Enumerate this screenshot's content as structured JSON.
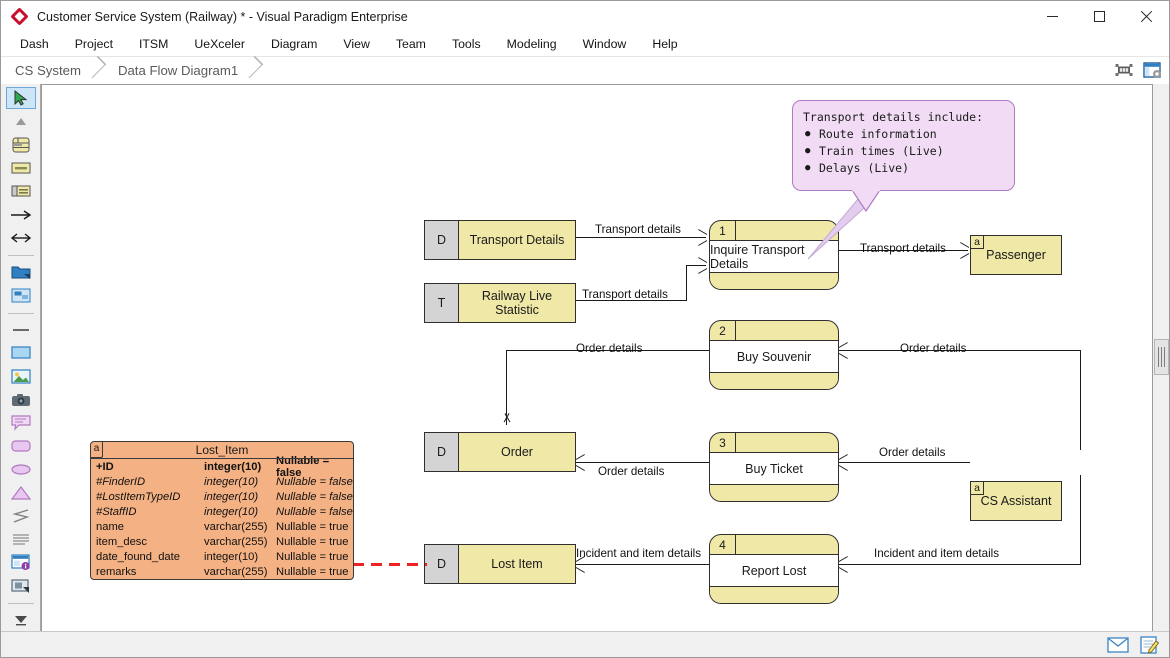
{
  "window": {
    "title": "Customer Service System (Railway) * - Visual Paradigm Enterprise",
    "logo_icon": "vp-diamond-logo-icon",
    "minimize_label": "—",
    "maximize_label": "□",
    "close_label": "✕"
  },
  "menubar": {
    "items": [
      {
        "label": "Dash"
      },
      {
        "label": "Project"
      },
      {
        "label": "ITSM"
      },
      {
        "label": "UeXceler"
      },
      {
        "label": "Diagram"
      },
      {
        "label": "View"
      },
      {
        "label": "Team"
      },
      {
        "label": "Tools"
      },
      {
        "label": "Modeling"
      },
      {
        "label": "Window"
      },
      {
        "label": "Help"
      }
    ]
  },
  "breadcrumb": {
    "items": [
      {
        "label": "CS System"
      },
      {
        "label": "Data Flow Diagram1"
      }
    ],
    "right_icons": [
      {
        "name": "fit-to-window-icon"
      },
      {
        "name": "open-specification-icon"
      }
    ]
  },
  "toolbar": {
    "items": [
      {
        "name": "pointer-select-tool",
        "selected": true
      },
      {
        "name": "zoom-collapse-tool",
        "selected": false
      },
      {
        "name": "process-shape-tool",
        "selected": false
      },
      {
        "name": "external-entity-shape-tool",
        "selected": false
      },
      {
        "name": "data-store-shape-tool",
        "selected": false
      },
      {
        "name": "data-flow-connector-tool",
        "selected": false
      },
      {
        "name": "bidirectional-flow-tool",
        "selected": false
      },
      {
        "name": "package-shape-tool",
        "selected": false
      },
      {
        "name": "subdiagram-tool",
        "selected": false
      },
      {
        "name": "line-shape-tool",
        "selected": false
      },
      {
        "name": "rectangle-shape-tool",
        "selected": false
      },
      {
        "name": "image-shape-tool",
        "selected": false
      },
      {
        "name": "screen-capture-tool",
        "selected": false
      },
      {
        "name": "callout-note-tool",
        "selected": false
      },
      {
        "name": "rounded-rectangle-tool",
        "selected": false
      },
      {
        "name": "ellipse-shape-tool",
        "selected": false
      },
      {
        "name": "triangle-shape-tool",
        "selected": false
      },
      {
        "name": "polyline-shape-tool",
        "selected": false
      },
      {
        "name": "text-lines-tool",
        "selected": false
      },
      {
        "name": "documentation-pane-tool",
        "selected": false
      },
      {
        "name": "annotation-stamp-tool",
        "selected": false
      },
      {
        "name": "more-tools-icon",
        "selected": false
      }
    ]
  },
  "statusbar": {
    "icons": [
      {
        "name": "mail-icon"
      },
      {
        "name": "edit-document-icon"
      }
    ]
  },
  "note": {
    "title": "Transport details include:",
    "bullets": [
      "Route information",
      "Train times (Live)",
      "Delays (Live)"
    ]
  },
  "diagram": {
    "data_stores": [
      {
        "letter": "D",
        "label": "Transport Details"
      },
      {
        "letter": "T",
        "label": "Railway Live Statistic"
      },
      {
        "letter": "D",
        "label": "Order"
      },
      {
        "letter": "D",
        "label": "Lost Item"
      }
    ],
    "processes": [
      {
        "number": "1",
        "label": "Inquire Transport Details"
      },
      {
        "number": "2",
        "label": "Buy Souvenir"
      },
      {
        "number": "3",
        "label": "Buy Ticket"
      },
      {
        "number": "4",
        "label": "Report Lost"
      }
    ],
    "external_entities": [
      {
        "marker": "a",
        "label": "Passenger"
      },
      {
        "marker": "a",
        "label": "CS Assistant"
      }
    ],
    "flow_labels": [
      {
        "text": "Transport details"
      },
      {
        "text": "Transport details"
      },
      {
        "text": "Transport details"
      },
      {
        "text": "Order details"
      },
      {
        "text": "Order details"
      },
      {
        "text": "Order details"
      },
      {
        "text": "Order details"
      },
      {
        "text": "Incident and item details"
      },
      {
        "text": "Incident and item details"
      }
    ]
  },
  "entity": {
    "marker": "a",
    "name": "Lost_Item",
    "columns": [
      {
        "name": "+ID",
        "type": "integer(10)",
        "nullable": "Nullable = false",
        "style": "pk"
      },
      {
        "name": "#FinderID",
        "type": "integer(10)",
        "nullable": "Nullable = false",
        "style": "fk"
      },
      {
        "name": "#LostItemTypeID",
        "type": "integer(10)",
        "nullable": "Nullable = false",
        "style": "fk"
      },
      {
        "name": "#StaffID",
        "type": "integer(10)",
        "nullable": "Nullable = false",
        "style": "fk"
      },
      {
        "name": "name",
        "type": "varchar(255)",
        "nullable": "Nullable = true",
        "style": ""
      },
      {
        "name": "item_desc",
        "type": "varchar(255)",
        "nullable": "Nullable = true",
        "style": ""
      },
      {
        "name": "date_found_date",
        "type": "integer(10)",
        "nullable": "Nullable = true",
        "style": ""
      },
      {
        "name": "remarks",
        "type": "varchar(255)",
        "nullable": "Nullable = true",
        "style": ""
      }
    ]
  },
  "colors": {
    "shape_fill": "#efe8a6",
    "datastore_letter_fill": "#d4d4d4",
    "entity_fill": "#f4b183",
    "note_fill": "#f2dcf5",
    "note_border": "#b07ac0",
    "association_red": "#ee2222",
    "selection_blue": "#cde6f7"
  }
}
